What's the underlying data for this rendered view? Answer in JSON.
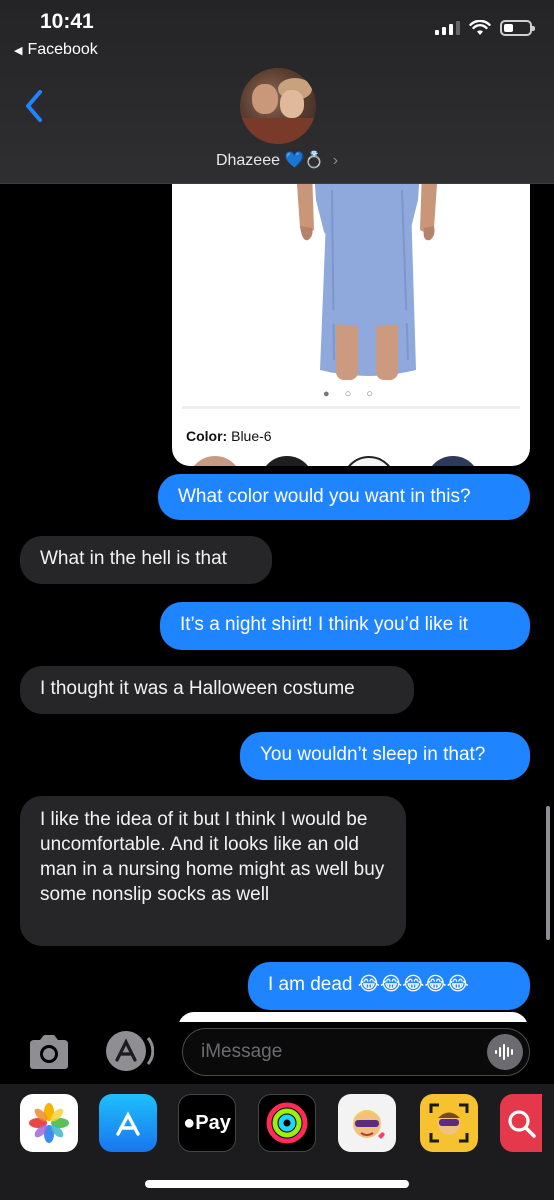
{
  "status_bar": {
    "time": "10:41",
    "back_app": "Facebook"
  },
  "header": {
    "contact_name": "Dhazeee",
    "contact_emoji": "💙💍",
    "chevron": "›"
  },
  "product": {
    "color_label": "Color:",
    "color_value": "Blue-6",
    "carousel_dots": "● ○ ○"
  },
  "messages": [
    {
      "direction": "sent",
      "text": "What color would you want in this?"
    },
    {
      "direction": "received",
      "text": "What in the hell is that"
    },
    {
      "direction": "sent",
      "text": "It’s a night shirt! I think you’d like it"
    },
    {
      "direction": "received",
      "text": "I thought it was a Halloween costume"
    },
    {
      "direction": "sent",
      "text": "You wouldn’t sleep in that?"
    },
    {
      "direction": "received",
      "text": "I like the idea of it but I think I would be uncomfortable. And it looks like an old man in a nursing home might as well buy some nonslip socks as well"
    },
    {
      "direction": "sent",
      "text": "I am dead 😂😂😂😂😂"
    }
  ],
  "input": {
    "placeholder": "iMessage"
  },
  "app_drawer": {
    "apple_pay_label": "Pay",
    "icons": [
      "photos-icon",
      "app-store-icon",
      "apple-pay-icon",
      "activity-icon",
      "memoji-icon",
      "memoji-sticker-icon",
      "search-images-icon"
    ]
  },
  "colors": {
    "sent_bubble": "#1f84ff",
    "received_bubble": "#262628",
    "product_dress": "#8fa9dc"
  }
}
